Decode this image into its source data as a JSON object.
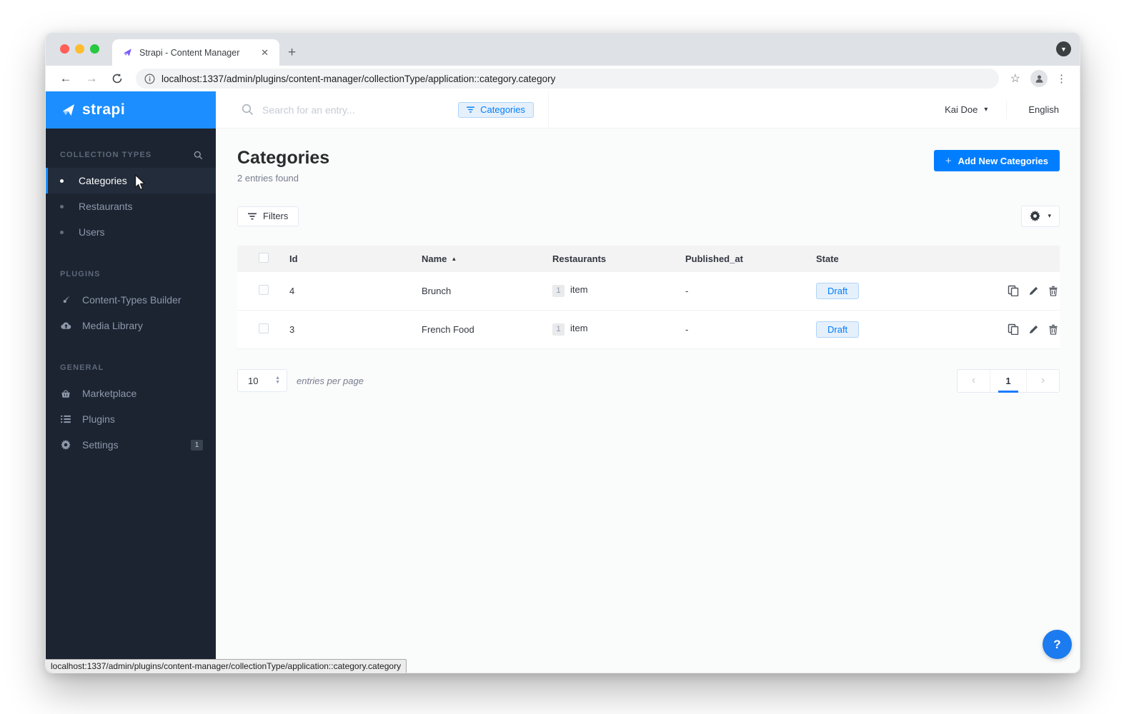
{
  "browser": {
    "tab_title": "Strapi - Content Manager",
    "url": "localhost:1337/admin/plugins/content-manager/collectionType/application::category.category",
    "status_url": "localhost:1337/admin/plugins/content-manager/collectionType/application::category.category"
  },
  "icons": {
    "close_tab": "✕",
    "new_tab": "+",
    "tab_menu_caret": "▼",
    "back_arrow": "←",
    "forward_arrow": "→",
    "star": "☆",
    "kebab": "⋮",
    "caret_down": "▾",
    "sort_asc": "▲",
    "pager_prev": "‹",
    "pager_next": "›",
    "plus": "+",
    "question": "?",
    "select_up": "▲",
    "select_down": "▼"
  },
  "sidebar": {
    "logo_text": "strapi",
    "sections": {
      "collection_types": {
        "label": "COLLECTION TYPES",
        "items": [
          {
            "label": "Categories"
          },
          {
            "label": "Restaurants"
          },
          {
            "label": "Users"
          }
        ]
      },
      "plugins": {
        "label": "PLUGINS",
        "items": [
          {
            "label": "Content-Types Builder"
          },
          {
            "label": "Media Library"
          }
        ]
      },
      "general": {
        "label": "GENERAL",
        "items": [
          {
            "label": "Marketplace"
          },
          {
            "label": "Plugins"
          },
          {
            "label": "Settings",
            "badge": "1"
          }
        ]
      }
    }
  },
  "topbar": {
    "search_placeholder": "Search for an entry...",
    "filter_chip_label": "Categories",
    "user_name": "Kai Doe",
    "language": "English"
  },
  "main": {
    "title": "Categories",
    "subtitle": "2 entries found",
    "add_button_label": "Add New Categories",
    "filters_button_label": "Filters",
    "table": {
      "headers": {
        "id": "Id",
        "name": "Name",
        "restaurants": "Restaurants",
        "published_at": "Published_at",
        "state": "State"
      },
      "sorted_column": "Name",
      "rows": [
        {
          "id": "4",
          "name": "Brunch",
          "restaurants_count": "1",
          "restaurants_label": "item",
          "published_at": "-",
          "state": "Draft"
        },
        {
          "id": "3",
          "name": "French Food",
          "restaurants_count": "1",
          "restaurants_label": "item",
          "published_at": "-",
          "state": "Draft"
        }
      ]
    },
    "footer": {
      "entries_per_page_value": "10",
      "entries_per_page_label": "entries per page",
      "current_page": "1"
    }
  },
  "colors": {
    "accent_blue": "#007eff",
    "header_blue": "#1c8eff",
    "sidebar_bg": "#1c2431",
    "draft_bg": "#e6f0fb",
    "draft_border": "#aed4fb"
  }
}
